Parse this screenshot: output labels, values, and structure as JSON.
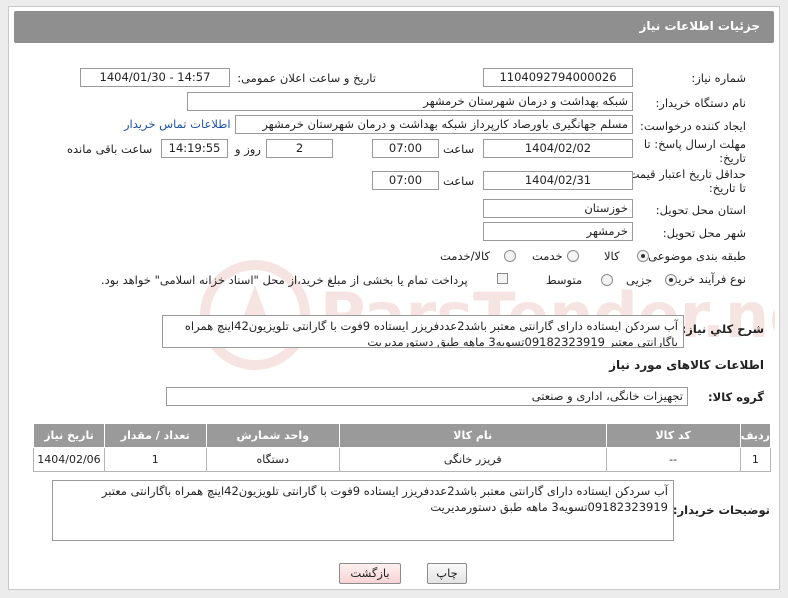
{
  "header": {
    "title": "جزئیات اطلاعات نیاز"
  },
  "fields": {
    "need_number": {
      "label": "شماره نیاز:",
      "value": "1104092794000026"
    },
    "announce_datetime": {
      "label": "تاریخ و ساعت اعلان عمومی:",
      "value": "1404/01/30 - 14:57"
    },
    "buyer_org": {
      "label": "نام دستگاه خریدار:",
      "value": "شبکه بهداشت و درمان شهرستان خرمشهر"
    },
    "requester": {
      "label": "ایجاد کننده درخواست:",
      "value": "مسلم جهانگیری باورصاد کارپرداز شبکه بهداشت و درمان شهرستان خرمشهر",
      "link": "اطلاعات تماس خریدار"
    },
    "reply_deadline": {
      "label_line1": "مهلت ارسال پاسخ: تا",
      "label_line2": "تاریخ:",
      "date": "1404/02/02",
      "time_label": "ساعت",
      "time": "07:00",
      "days": "2",
      "days_label": "روز و",
      "remaining": "14:19:55",
      "remaining_label": "ساعت باقی مانده"
    },
    "price_validity": {
      "label_line1": "حداقل تاریخ اعتبار قیمت:",
      "label_line2": "تا تاریخ:",
      "date": "1404/02/31",
      "time_label": "ساعت",
      "time": "07:00"
    },
    "province": {
      "label": "استان محل تحویل:",
      "value": "خوزستان"
    },
    "city": {
      "label": "شهر محل تحویل:",
      "value": "خرمشهر"
    },
    "category": {
      "label": "طبقه بندی موضوعی:",
      "options": [
        "کالا",
        "خدمت",
        "کالا/خدمت"
      ],
      "selected": 0
    },
    "process": {
      "label": "نوع فرآیند خرید :",
      "options": [
        "جزیی",
        "متوسط"
      ],
      "selected": 0,
      "treasury_note": "پرداخت تمام یا بخشی از مبلغ خرید،از محل \"اسناد خزانه اسلامی\" خواهد بود."
    },
    "description": {
      "label": "شرح كلي نياز:",
      "value": "آب سردکن ایستاده دارای گارانتی معتبر باشد2عددفریزر ایستاده 9فوت با گارانتی تلویزیون42اینچ همراه باگارانتی معتبر 09182323919تسویه3 ماهه طبق دستورمدیریت"
    }
  },
  "goods_section": {
    "title": "اطلاعات کالاهای مورد نیاز",
    "group_label": "گروه کالا:",
    "group_value": "تجهیزات خانگی، اداری و صنعتی",
    "columns": [
      "ردیف",
      "کد کالا",
      "نام کالا",
      "واحد شمارش",
      "تعداد / مقدار",
      "تاریخ نیاز"
    ],
    "rows": [
      [
        "1",
        "--",
        "فریزر خانگی",
        "دستگاه",
        "1",
        "1404/02/06"
      ]
    ]
  },
  "buyer_notes": {
    "label": "توضیحات خریدار:",
    "value": "آب سردکن ایستاده دارای گارانتی معتبر باشد2عددفریزر ایستاده 9فوت با گارانتی تلویزیون42اینچ همراه باگارانتی معتبر 09182323919تسویه3 ماهه طبق دستورمدیریت"
  },
  "buttons": {
    "print": "چاپ",
    "back": "بازگشت"
  },
  "colors": {
    "header_bg": "#8f8f8f",
    "table_header_bg": "#9a9a9a",
    "link": "#2054a8",
    "back_button_bg": "#fde4e4"
  },
  "watermark": {
    "text": "ParsTender.net"
  }
}
